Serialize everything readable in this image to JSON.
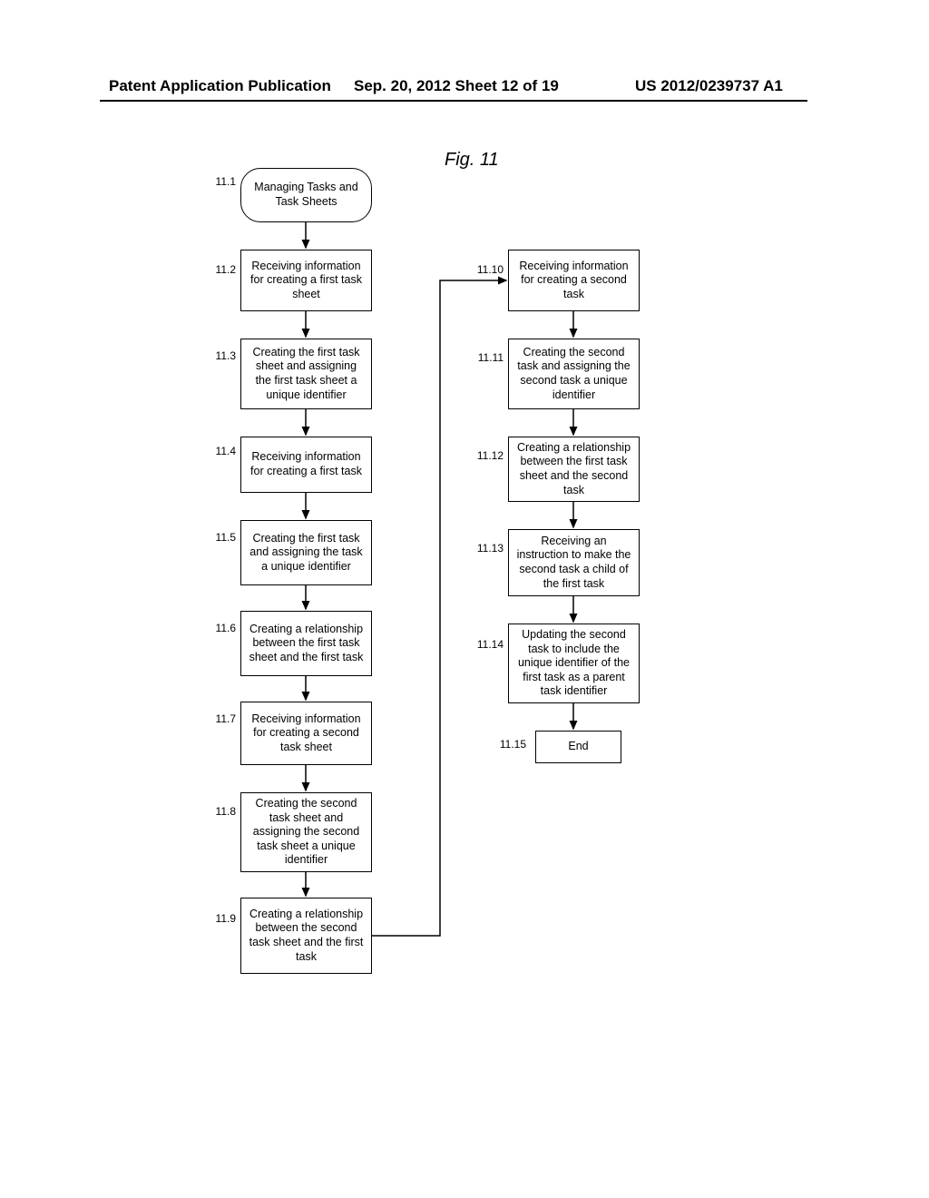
{
  "header": {
    "left": "Patent Application Publication",
    "center": "Sep. 20, 2012  Sheet 12 of 19",
    "right": "US 2012/0239737 A1"
  },
  "figure_title": "Fig. 11",
  "left_column": [
    {
      "num": "11.1",
      "text": "Managing Tasks and Task Sheets",
      "rounded": true
    },
    {
      "num": "11.2",
      "text": "Receiving information for creating a first task sheet"
    },
    {
      "num": "11.3",
      "text": "Creating the first task sheet and assigning the first task sheet a unique identifier"
    },
    {
      "num": "11.4",
      "text": "Receiving information for creating a first task"
    },
    {
      "num": "11.5",
      "text": "Creating the first task and assigning the task a unique identifier"
    },
    {
      "num": "11.6",
      "text": "Creating a relationship between the first task sheet and the first task"
    },
    {
      "num": "11.7",
      "text": "Receiving information for creating a second task sheet"
    },
    {
      "num": "11.8",
      "text": "Creating the second task sheet and assigning the second task sheet a unique identifier"
    },
    {
      "num": "11.9",
      "text": "Creating a relationship between the second task sheet and the first task"
    }
  ],
  "right_column": [
    {
      "num": "11.10",
      "text": "Receiving information for creating a second task"
    },
    {
      "num": "11.11",
      "text": "Creating the second task and assigning the second task a unique identifier"
    },
    {
      "num": "11.12",
      "text": "Creating a relationship between the first task sheet and the second task"
    },
    {
      "num": "11.13",
      "text": "Receiving an instruction to make the second task a child of the first task"
    },
    {
      "num": "11.14",
      "text": "Updating the second task to include the unique identifier of the first task as a parent task identifier"
    },
    {
      "num": "11.15",
      "text": "End"
    }
  ]
}
